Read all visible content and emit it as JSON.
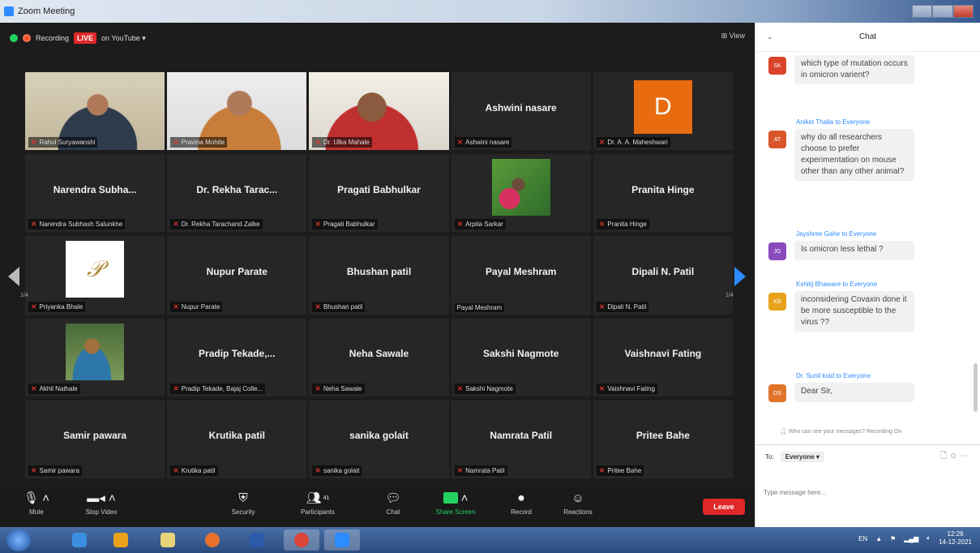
{
  "window": {
    "title": "Zoom Meeting"
  },
  "status": {
    "recording_label": "Recording",
    "live_badge": "LIVE",
    "live_target": "on YouTube ▾",
    "view_label": "⊞ View"
  },
  "tiles": [
    {
      "name": "",
      "label": "Rahul Suryawanshi",
      "style": "p1",
      "active": true
    },
    {
      "name": "",
      "label": "Pravina Mohite",
      "style": "p2"
    },
    {
      "name": "",
      "label": "Dr. Ulka Mahale",
      "style": "p3"
    },
    {
      "name": "Ashwini nasare",
      "label": "Ashwini nasare"
    },
    {
      "name": "",
      "label": "Dr. A. A. Maheshwari",
      "thumb": "orange",
      "thumb_text": "D"
    },
    {
      "name": "Narendra  Subha...",
      "label": "Narendra Subhash Salunkhe"
    },
    {
      "name": "Dr. Rekha Tarac...",
      "label": "Dr. Rekha Tarachand Zalke"
    },
    {
      "name": "Pragati Babhulkar",
      "label": "Pragati Babhulkar"
    },
    {
      "name": "",
      "label": "Arpita Sarkar",
      "thumb": "flowers"
    },
    {
      "name": "Pranita Hinge",
      "label": "Pranita Hinge"
    },
    {
      "name": "",
      "label": "Priyanka Bhale",
      "thumb": "logo",
      "thumb_text": "𝒫"
    },
    {
      "name": "Nupur Parate",
      "label": "Nupur Parate"
    },
    {
      "name": "Bhushan patil",
      "label": "Bhushan patil"
    },
    {
      "name": "Payal Meshram",
      "label": "Payal Meshram",
      "nomic": true
    },
    {
      "name": "Dipali N. Patil",
      "label": "Dipali N. Patil"
    },
    {
      "name": "",
      "label": "Akhil Nathale",
      "thumb": "boy"
    },
    {
      "name": "Pradip  Tekade,...",
      "label": "Pradip Tekade, Bajaj Colle..."
    },
    {
      "name": "Neha Sawale",
      "label": "Neha Sawale"
    },
    {
      "name": "Sakshi Nagmote",
      "label": "Sakshi Nagmote"
    },
    {
      "name": "Vaishnavi Fating",
      "label": "Vaishnavi Fating"
    },
    {
      "name": "Samir pawara",
      "label": "Samir pawara"
    },
    {
      "name": "Krutika patil",
      "label": "Krutika patil"
    },
    {
      "name": "sanika golait",
      "label": "sanika golait"
    },
    {
      "name": "Namrata Patil",
      "label": "Namrata Patil"
    },
    {
      "name": "Pritee Bahe",
      "label": "Pritee Bahe"
    }
  ],
  "pager": {
    "left": "1/4",
    "right": "1/4"
  },
  "toolbar": {
    "mute": "Mute",
    "stop_video": "Stop Video",
    "security": "Security",
    "participants": "Participants",
    "participants_count": "41",
    "chat": "Chat",
    "share_screen": "Share Screen",
    "record": "Record",
    "reactions": "Reactions",
    "leave": "Leave"
  },
  "chat": {
    "title": "Chat",
    "messages": [
      {
        "sender": "",
        "initials": "SK",
        "color": "#d9442a",
        "text": "which type of mutation occurs in omicron varient?"
      },
      {
        "sender": "Aniket Thalla to Everyone",
        "initials": "AT",
        "color": "#d9552a",
        "text": "why do all researchers choose to prefer experimentation on mouse other than any other animal?"
      },
      {
        "sender": "Jayshree Gahe to Everyone",
        "initials": "JG",
        "color": "#8a4bbd",
        "text": "Is omicron less lethal ?"
      },
      {
        "sender": "Kshitij Bhaware to Everyone",
        "initials": "KB",
        "color": "#e8a21c",
        "text": "inconsidering  Covaxin done it be more susceptible to the virus ??"
      },
      {
        "sender": "Dr. Sunil kold to Everyone",
        "initials": "DS",
        "color": "#e0742a",
        "text": "Dear Sir,"
      }
    ],
    "privacy": "Who can see your messages? Recording On",
    "to_label": "To:",
    "to_value": "Everyone ▾",
    "input_placeholder": "Type message here..."
  },
  "taskbar": {
    "lang": "EN",
    "time": "12:26",
    "date": "14-12-2021"
  }
}
